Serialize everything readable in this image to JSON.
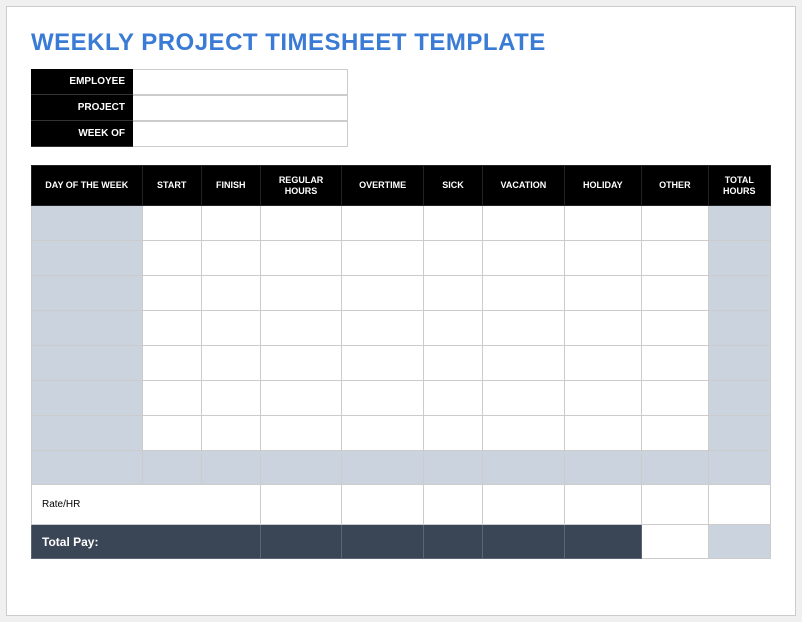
{
  "title": "WEEKLY PROJECT TIMESHEET TEMPLATE",
  "info": {
    "employee_label": "EMPLOYEE",
    "employee_value": "",
    "project_label": "PROJECT",
    "project_value": "",
    "weekof_label": "WEEK OF",
    "weekof_value": ""
  },
  "columns": {
    "day": "DAY OF THE WEEK",
    "start": "START",
    "finish": "FINISH",
    "regular_hours": "REGULAR HOURS",
    "overtime": "OVERTIME",
    "sick": "SICK",
    "vacation": "VACATION",
    "holiday": "HOLIDAY",
    "other": "OTHER",
    "total_hours": "TOTAL HOURS"
  },
  "rows": [
    {
      "day": "",
      "start": "",
      "finish": "",
      "regular": "",
      "overtime": "",
      "sick": "",
      "vacation": "",
      "holiday": "",
      "other": "",
      "total": ""
    },
    {
      "day": "",
      "start": "",
      "finish": "",
      "regular": "",
      "overtime": "",
      "sick": "",
      "vacation": "",
      "holiday": "",
      "other": "",
      "total": ""
    },
    {
      "day": "",
      "start": "",
      "finish": "",
      "regular": "",
      "overtime": "",
      "sick": "",
      "vacation": "",
      "holiday": "",
      "other": "",
      "total": ""
    },
    {
      "day": "",
      "start": "",
      "finish": "",
      "regular": "",
      "overtime": "",
      "sick": "",
      "vacation": "",
      "holiday": "",
      "other": "",
      "total": ""
    },
    {
      "day": "",
      "start": "",
      "finish": "",
      "regular": "",
      "overtime": "",
      "sick": "",
      "vacation": "",
      "holiday": "",
      "other": "",
      "total": ""
    },
    {
      "day": "",
      "start": "",
      "finish": "",
      "regular": "",
      "overtime": "",
      "sick": "",
      "vacation": "",
      "holiday": "",
      "other": "",
      "total": ""
    },
    {
      "day": "",
      "start": "",
      "finish": "",
      "regular": "",
      "overtime": "",
      "sick": "",
      "vacation": "",
      "holiday": "",
      "other": "",
      "total": ""
    }
  ],
  "summary": {
    "rate_label": "Rate/HR",
    "rate_values": {
      "regular": "",
      "overtime": "",
      "sick": "",
      "vacation": "",
      "holiday": "",
      "other": "",
      "total": ""
    },
    "total_pay_label": "Total Pay:",
    "total_pay_values": {
      "regular": "",
      "overtime": "",
      "sick": "",
      "vacation": "",
      "holiday": "",
      "other": "",
      "total": ""
    }
  }
}
